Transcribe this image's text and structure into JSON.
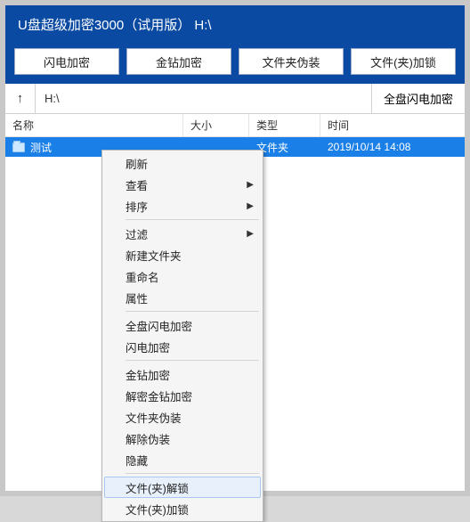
{
  "title": "U盘超级加密3000（试用版）  H:\\",
  "toolbar": {
    "btn1": "闪电加密",
    "btn2": "金钻加密",
    "btn3": "文件夹伪装",
    "btn4": "文件(夹)加锁"
  },
  "address": {
    "path": "H:\\",
    "up_symbol": "↑",
    "full_enc": "全盘闪电加密"
  },
  "columns": {
    "name": "名称",
    "size": "大小",
    "type": "类型",
    "time": "时间"
  },
  "rows": [
    {
      "name": "测试",
      "size": "",
      "type": "文件夹",
      "time": "2019/10/14 14:08"
    }
  ],
  "context_menu": {
    "items": [
      {
        "label": "刷新"
      },
      {
        "label": "查看",
        "submenu": true
      },
      {
        "label": "排序",
        "submenu": true
      },
      {
        "sep": true
      },
      {
        "label": "过滤",
        "submenu": true
      },
      {
        "label": "新建文件夹"
      },
      {
        "label": "重命名"
      },
      {
        "label": "属性"
      },
      {
        "sep": true
      },
      {
        "label": "全盘闪电加密"
      },
      {
        "label": "闪电加密"
      },
      {
        "sep": true
      },
      {
        "label": "金钻加密"
      },
      {
        "label": "解密金钻加密"
      },
      {
        "label": "文件夹伪装"
      },
      {
        "label": "解除伪装"
      },
      {
        "label": "隐藏"
      },
      {
        "sep": true
      },
      {
        "label": "文件(夹)解锁",
        "hover": true
      },
      {
        "label": "文件(夹)加锁"
      }
    ],
    "submenu_symbol": "▶"
  }
}
